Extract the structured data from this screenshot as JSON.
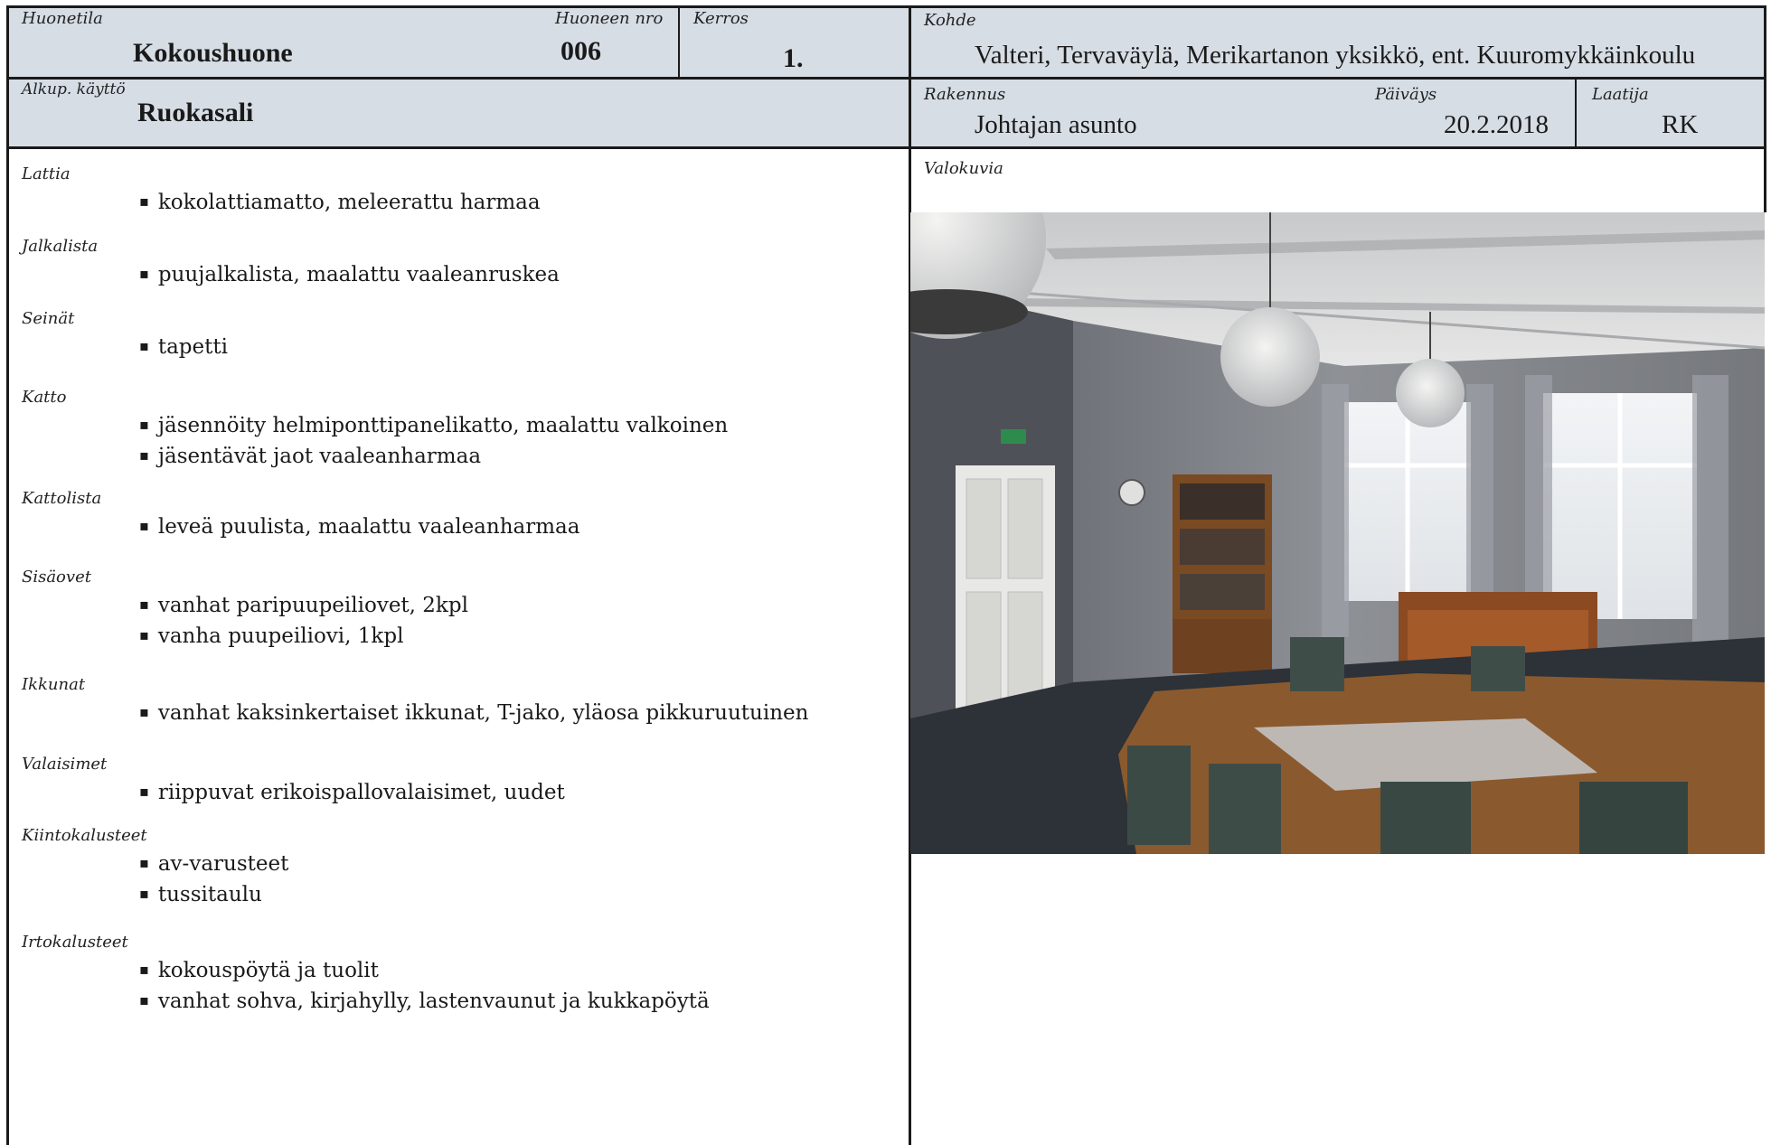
{
  "header": {
    "huonetila": {
      "label": "Huonetila",
      "value": "Kokoushuone"
    },
    "huoneen_nro": {
      "label": "Huoneen nro",
      "value": "006"
    },
    "kerros": {
      "label": "Kerros",
      "value": "1."
    },
    "kohde": {
      "label": "Kohde",
      "value": "Valteri, Tervaväylä, Merikartanon yksikkö, ent. Kuuromykkäinkoulu"
    },
    "alkup_kaytto": {
      "label": "Alkup. käyttö",
      "value": "Ruokasali"
    },
    "rakennus": {
      "label": "Rakennus",
      "value": "Johtajan asunto"
    },
    "paivays": {
      "label": "Päiväys",
      "value": "20.2.2018"
    },
    "laatija": {
      "label": "Laatija",
      "value": "RK"
    }
  },
  "photos_label": "Valokuvia",
  "sections": [
    {
      "label": "Lattia",
      "items": [
        "kokolattiamatto, meleerattu harmaa"
      ]
    },
    {
      "label": "Jalkalista",
      "items": [
        "puujalkalista, maalattu vaaleanruskea"
      ]
    },
    {
      "label": "Seinät",
      "items": [
        "tapetti"
      ]
    },
    {
      "label": "Katto",
      "items": [
        "jäsennöity helmiponttipanelikatto, maalattu valkoinen",
        "jäsentävät jaot vaaleanharmaa"
      ]
    },
    {
      "label": "Kattolista",
      "items": [
        "leveä puulista, maalattu vaaleanharmaa"
      ]
    },
    {
      "label": "Sisäovet",
      "items": [
        "vanhat paripuupeiliovet, 2kpl",
        "vanha puupeiliovi, 1kpl"
      ]
    },
    {
      "label": "Ikkunat",
      "items": [
        "vanhat kaksinkertaiset ikkunat, T-jako, yläosa pikkuruutuinen"
      ]
    },
    {
      "label": "Valaisimet",
      "items": [
        "riippuvat erikoispallovalaisimet, uudet"
      ]
    },
    {
      "label": "Kiintokalusteet",
      "items": [
        "av-varusteet",
        "tussitaulu"
      ]
    },
    {
      "label": "Irtokalusteet",
      "items": [
        "kokouspöytä ja tuolit",
        "vanhat sohva, kirjahylly, lastenvaunut ja kukkapöytä"
      ]
    }
  ],
  "colors": {
    "header_bg": "#d6dde5",
    "rule": "#1a1a1a"
  }
}
